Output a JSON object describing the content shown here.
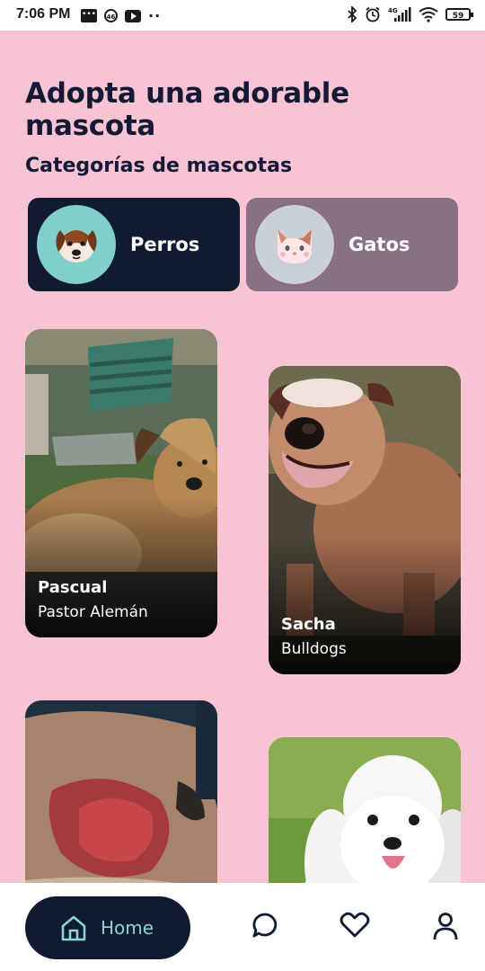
{
  "status_bar": {
    "time": "7:06 PM",
    "icons_left": [
      "message-icon",
      "badge-46-icon",
      "youtube-icon",
      "more-dots-icon"
    ],
    "badge_46": "46",
    "dots": "··",
    "icons_right": [
      "bluetooth-icon",
      "alarm-icon",
      "signal-4g-icon",
      "wifi-icon",
      "battery-icon"
    ],
    "battery": "59"
  },
  "header": {
    "title": "Adopta una adorable mascota"
  },
  "categories": {
    "title": "Categorías de mascotas",
    "items": [
      {
        "label": "Perros",
        "icon": "dog-icon",
        "active": true
      },
      {
        "label": "Gatos",
        "icon": "cat-icon",
        "active": false
      }
    ]
  },
  "pets": [
    {
      "name": "Pascual",
      "breed": "Pastor Alemán",
      "photo": "terrier-dog-photo"
    },
    {
      "name": "Sacha",
      "breed": "Bulldogs",
      "photo": "bulldog-photo"
    },
    {
      "name": "",
      "breed": "",
      "photo": "injured-dog-photo"
    },
    {
      "name": "",
      "breed": "",
      "photo": "poodle-photo"
    }
  ],
  "bottom_nav": {
    "home_label": "Home",
    "items": [
      "home-icon",
      "chat-icon",
      "heart-icon",
      "profile-icon"
    ]
  },
  "colors": {
    "background": "#f8c4d4",
    "dark_navy": "#101a30",
    "accent_teal": "#8fd3cf",
    "cat_card": "#8a7084"
  }
}
